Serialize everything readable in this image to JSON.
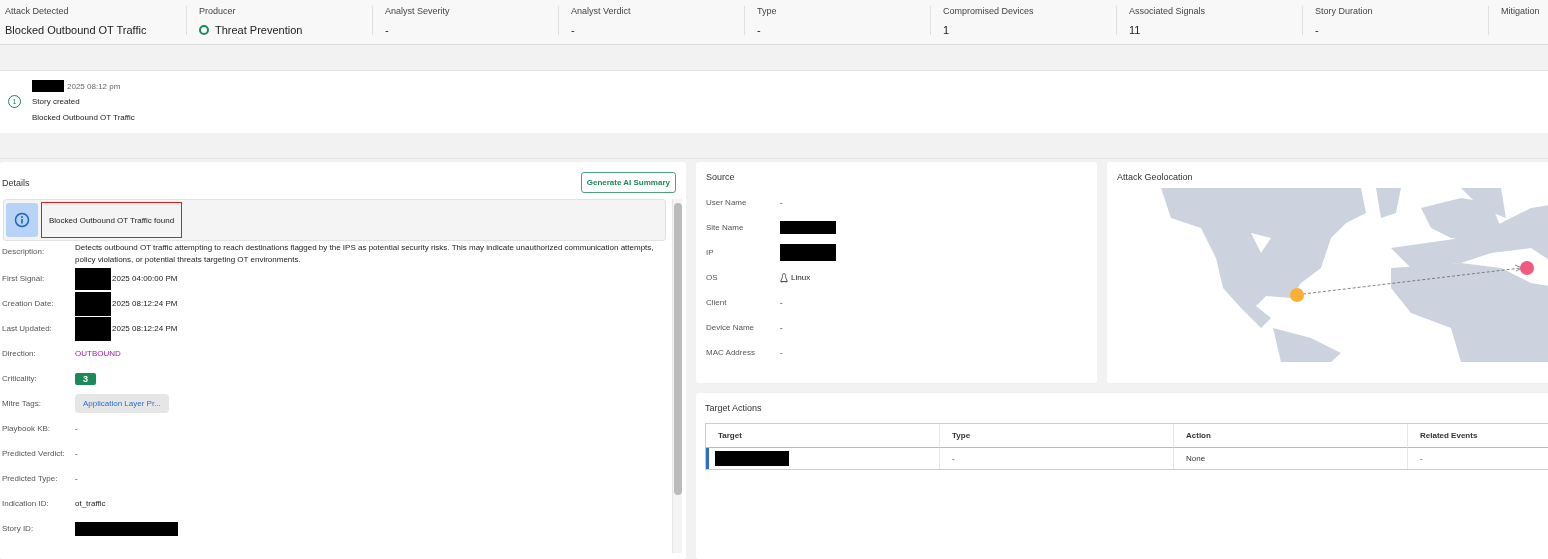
{
  "summary": [
    {
      "label": "Attack Detected",
      "value": "Blocked Outbound OT Traffic",
      "kind": "text"
    },
    {
      "label": "Producer",
      "value": "Threat Prevention",
      "kind": "status"
    },
    {
      "label": "Analyst Severity",
      "value": "-",
      "kind": "text"
    },
    {
      "label": "Analyst Verdict",
      "value": "-",
      "kind": "text"
    },
    {
      "label": "Type",
      "value": "-",
      "kind": "text"
    },
    {
      "label": "Compromised Devices",
      "value": "1",
      "kind": "text"
    },
    {
      "label": "Associated Signals",
      "value": "11",
      "kind": "text"
    },
    {
      "label": "Story Duration",
      "value": "-",
      "kind": "text"
    },
    {
      "label": "Mitigation"
    }
  ],
  "timeline": {
    "time": "2025 08:12 pm",
    "step": "1",
    "title": "Story created",
    "subtitle": "Blocked Outbound OT Traffic"
  },
  "details": {
    "title": "Details",
    "button": "Generate AI Summary",
    "alert": "Blocked Outbound OT Traffic found",
    "fields": [
      {
        "label": "Description:",
        "value": "Detects outbound OT traffic attempting to reach destinations flagged by the IPS as potential security risks. This may indicate unauthorized communication attempts, policy violations, or potential threats targeting OT environments.",
        "kind": "text"
      },
      {
        "label": "First Signal:",
        "value": "2025 04:00:00 PM",
        "kind": "date"
      },
      {
        "label": "Creation Date:",
        "value": "2025 08:12:24 PM",
        "kind": "date"
      },
      {
        "label": "Last Updated:",
        "value": "2025 08:12:24 PM",
        "kind": "date"
      },
      {
        "label": "Direction:",
        "value": "OUTBOUND",
        "kind": "direction"
      },
      {
        "label": "Criticality:",
        "value": "3",
        "kind": "badge"
      },
      {
        "label": "Mitre Tags:",
        "value": "Application Layer Pr...",
        "kind": "tag"
      },
      {
        "label": "Playbook KB:",
        "value": "-",
        "kind": "text"
      },
      {
        "label": "Predicted Verdict:",
        "value": "-",
        "kind": "text"
      },
      {
        "label": "Predicted Type:",
        "value": "-",
        "kind": "text"
      },
      {
        "label": "Indication ID:",
        "value": "ot_traffic",
        "kind": "text"
      },
      {
        "label": "Story ID:",
        "kind": "redacted"
      }
    ]
  },
  "source": {
    "title": "Source",
    "fields": [
      {
        "label": "User Name",
        "value": "-",
        "kind": "text"
      },
      {
        "label": "Site Name",
        "kind": "redacted"
      },
      {
        "label": "IP",
        "kind": "redacted"
      },
      {
        "label": "OS",
        "value": "Linux",
        "kind": "os"
      },
      {
        "label": "Client",
        "value": "-",
        "kind": "text"
      },
      {
        "label": "Device Name",
        "value": "-",
        "kind": "text"
      },
      {
        "label": "MAC Address",
        "value": "-",
        "kind": "text"
      }
    ]
  },
  "geo": {
    "title": "Attack Geolocation"
  },
  "targets": {
    "title": "Target Actions",
    "columns": [
      "Target",
      "Type",
      "Action",
      "Related Events"
    ],
    "rows": [
      {
        "selected": true,
        "cells": [
          {
            "kind": "redacted"
          },
          {
            "kind": "text",
            "value": "-"
          },
          {
            "kind": "text",
            "value": "None"
          },
          {
            "kind": "text",
            "value": "-"
          }
        ]
      }
    ]
  }
}
